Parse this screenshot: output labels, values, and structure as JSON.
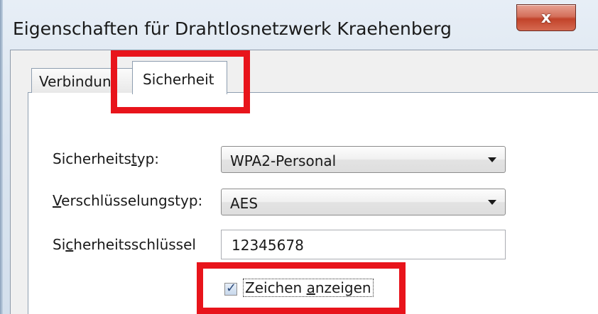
{
  "window": {
    "title": "Eigenschaften für Drahtlosnetzwerk Kraehenberg",
    "close_glyph": "x"
  },
  "tabs": [
    {
      "label": "Verbindung",
      "active": false
    },
    {
      "label": "Sicherheit",
      "active": true
    }
  ],
  "tab_visible_text": {
    "verbindung": "Verbindun"
  },
  "form": {
    "security_type": {
      "label_pre": "Sicherheits",
      "label_accel": "t",
      "label_post": "yp:",
      "value": "WPA2-Personal"
    },
    "encryption_type": {
      "label_accel": "V",
      "label_post": "erschlüsselungstyp:",
      "value": "AES"
    },
    "security_key": {
      "label_pre": "Si",
      "label_accel": "c",
      "label_post": "herheitsschlüssel",
      "value": "12345678"
    },
    "show_characters": {
      "label_pre": "Zeichen ",
      "label_accel": "a",
      "label_post": "nzeigen",
      "checked": true
    }
  },
  "colors": {
    "highlight": "#e8141b",
    "close_button": "#c2432a"
  }
}
